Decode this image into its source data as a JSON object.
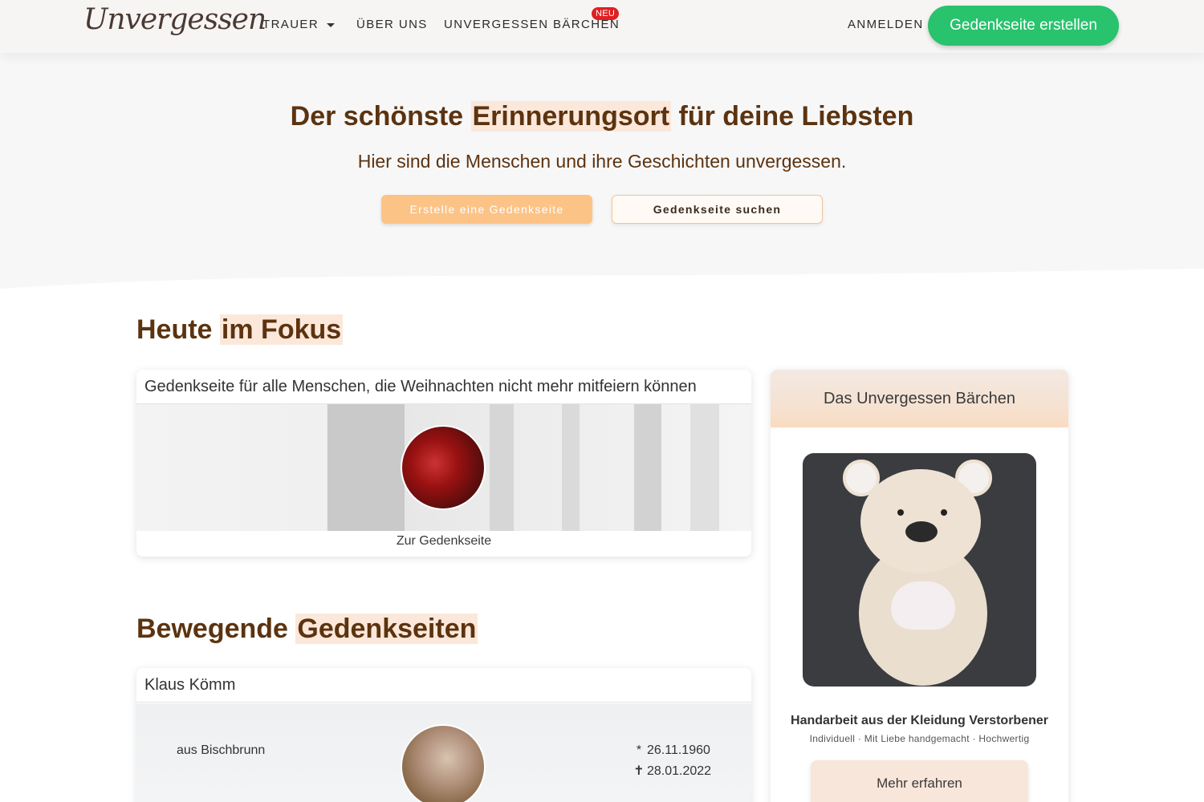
{
  "header": {
    "logo": "Unvergessen",
    "nav": {
      "trauer": "TRAUER",
      "ueber_uns": "ÜBER UNS",
      "baerchen": "UNVERGESSEN BÄRCHEN",
      "neu_badge": "NEU",
      "anmelden": "ANMELDEN"
    },
    "cta": "Gedenkseite erstellen"
  },
  "hero": {
    "title_pre": "Der schönste ",
    "title_highlight": "Erinnerungsort",
    "title_post": " für deine Liebsten",
    "subtitle": "Hier sind die Menschen und ihre Geschichten unvergessen.",
    "btn_create": "Erstelle eine Gedenkseite",
    "btn_search": "Gedenkseite suchen"
  },
  "fokus": {
    "title_pre": "Heute ",
    "title_highlight": "im Fokus",
    "card_title": "Gedenkseite für alle Menschen, die Weihnachten nicht mehr mitfeiern können",
    "link": "Zur Gedenkseite"
  },
  "bewegend": {
    "title_pre": "Bewegende ",
    "title_highlight": "Gedenkseiten",
    "card": {
      "name": "Klaus Kömm",
      "ort": "aus Bischbrunn",
      "born_symbol": "*",
      "born": "26.11.1960",
      "died_symbol": "✝",
      "died": "28.01.2022"
    }
  },
  "baerchen": {
    "title": "Das Unvergessen Bärchen",
    "caption": "Handarbeit aus der Kleidung Verstorbener",
    "tags": "Individuell  ·  Mit Liebe handgemacht  ·  Hochwertig",
    "button": "Mehr erfahren"
  },
  "colors": {
    "accent_green": "#29c26d",
    "heading_brown": "#5c3310",
    "highlight_peach": "#fbe8da",
    "orange_button": "#fcc387",
    "neu_red": "#e02020"
  }
}
